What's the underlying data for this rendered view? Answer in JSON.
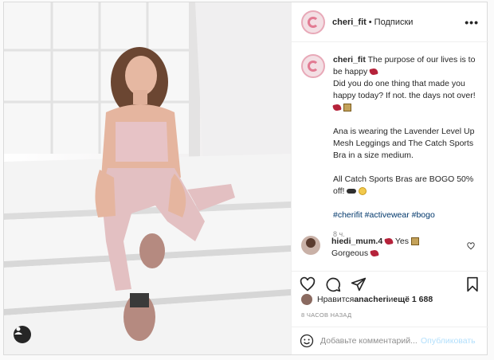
{
  "post": {
    "username": "cheri_fit",
    "separator": "•",
    "follow_label": "Подписки",
    "more_label": "•••"
  },
  "caption": {
    "username": "cheri_fit",
    "line1": " The purpose of our lives is to be happy ",
    "line2": "Did you do one thing that made you happy today? If not. the days not over! ",
    "para2": "Ana is wearing the Lavender Level Up Mesh Leggings and The Catch Sports Bra in a size medium.",
    "para3": "All Catch Sports Bras are BOGO 50% off! ",
    "hashtags": "#cherifit #activewear #bogo",
    "time": "8 ч."
  },
  "comment": {
    "username": "hiedi_mum.4",
    "text_a": " Yes ",
    "text_b": "Gorgeous "
  },
  "likes": {
    "prefix": "Нравится ",
    "user": "anacheri",
    "middle": " и ",
    "others": "ещё 1 688"
  },
  "age": "8 ЧАСОВ НАЗАД",
  "add_comment": {
    "placeholder": "Добавьте комментарий...",
    "post_label": "Опубликовать"
  },
  "icons": {
    "like": "heart-icon",
    "comment": "comment-icon",
    "share": "send-icon",
    "save": "bookmark-icon",
    "emoji": "emoji-icon",
    "more": "more-icon",
    "user_tags": "user-icon"
  },
  "colors": {
    "link": "#00376b",
    "muted": "#8e8e8e",
    "post_button": "#b2dffc",
    "heart_emoji": "#b5223a"
  }
}
